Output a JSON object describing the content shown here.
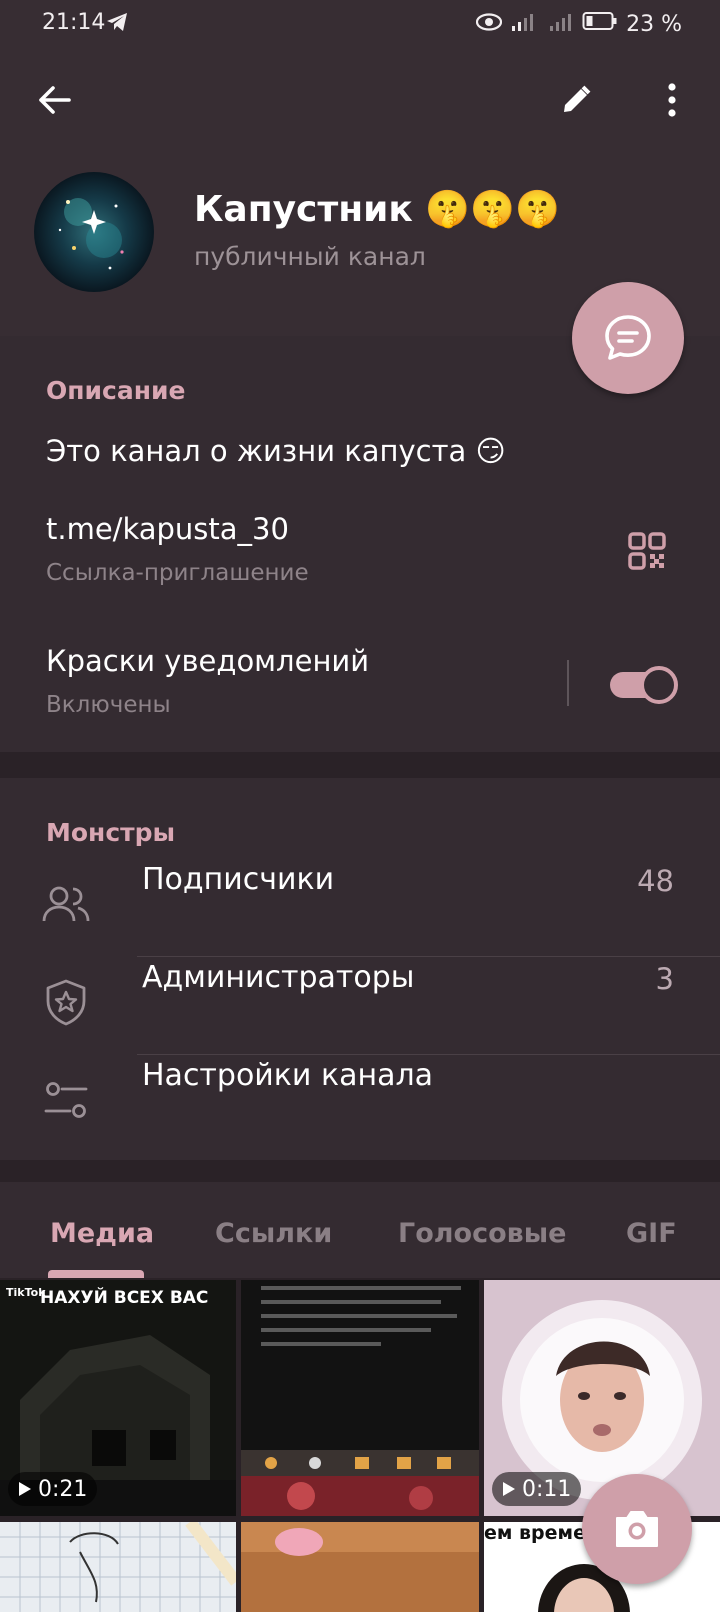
{
  "status_bar": {
    "time": "21:14",
    "battery": "23 %"
  },
  "channel": {
    "title": "Капустник 🤫🤫🤫",
    "subtitle": "публичный канал"
  },
  "info": {
    "section_title": "Описание",
    "description": "Это канал о жизни капуста 😏",
    "link": "t.me/kapusta_30",
    "link_caption": "Ссылка-приглашение",
    "notifications_label": "Краски уведомлений",
    "notifications_state": "Включены",
    "notifications_enabled": true
  },
  "members": {
    "section_title": "Монстры",
    "rows": [
      {
        "label": "Подписчики",
        "count": "48",
        "icon": "people-icon"
      },
      {
        "label": "Администраторы",
        "count": "3",
        "icon": "shield-star-icon"
      },
      {
        "label": "Настройки канала",
        "count": "",
        "icon": "sliders-icon"
      }
    ]
  },
  "tabs": [
    {
      "label": "Медиа",
      "active": true
    },
    {
      "label": "Ссылки",
      "active": false
    },
    {
      "label": "Голосовые",
      "active": false
    },
    {
      "label": "GIF",
      "active": false
    }
  ],
  "media": [
    {
      "caption": "НАХУЙ ВСЕХ ВАС",
      "badge": "TikTok",
      "duration": "0:21"
    },
    {
      "caption": "",
      "duration": ""
    },
    {
      "caption": "",
      "duration": "0:11"
    },
    {
      "caption": "",
      "duration": ""
    },
    {
      "caption": "",
      "duration": ""
    },
    {
      "caption": "ем времен",
      "duration": ""
    }
  ],
  "colors": {
    "accent": "#d9a7b3",
    "fab": "#cf9fa9",
    "background": "#2a2227",
    "card": "#342b31"
  }
}
